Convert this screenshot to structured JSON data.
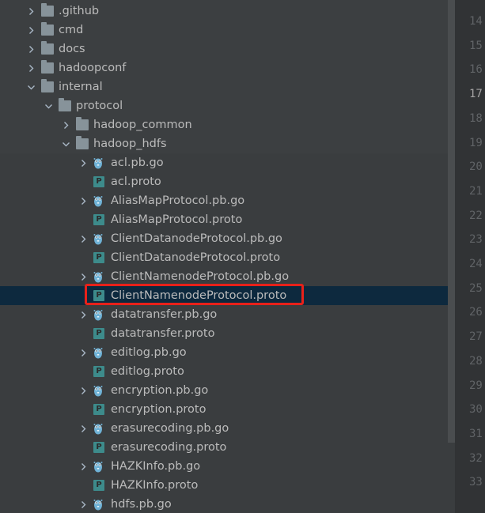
{
  "tree": {
    "rows": [
      {
        "label": ".github",
        "icon": "folder",
        "depth": 0,
        "chevron": "right"
      },
      {
        "label": "cmd",
        "icon": "folder",
        "depth": 0,
        "chevron": "right"
      },
      {
        "label": "docs",
        "icon": "folder",
        "depth": 0,
        "chevron": "right"
      },
      {
        "label": "hadoopconf",
        "icon": "folder",
        "depth": 0,
        "chevron": "right"
      },
      {
        "label": "internal",
        "icon": "folder",
        "depth": 0,
        "chevron": "down"
      },
      {
        "label": "protocol",
        "icon": "folder",
        "depth": 1,
        "chevron": "down"
      },
      {
        "label": "hadoop_common",
        "icon": "folder",
        "depth": 2,
        "chevron": "right"
      },
      {
        "label": "hadoop_hdfs",
        "icon": "folder",
        "depth": 2,
        "chevron": "down"
      },
      {
        "label": "acl.pb.go",
        "icon": "go",
        "depth": 3,
        "chevron": "right"
      },
      {
        "label": "acl.proto",
        "icon": "proto",
        "depth": 3,
        "chevron": "none"
      },
      {
        "label": "AliasMapProtocol.pb.go",
        "icon": "go",
        "depth": 3,
        "chevron": "right"
      },
      {
        "label": "AliasMapProtocol.proto",
        "icon": "proto",
        "depth": 3,
        "chevron": "none"
      },
      {
        "label": "ClientDatanodeProtocol.pb.go",
        "icon": "go",
        "depth": 3,
        "chevron": "right"
      },
      {
        "label": "ClientDatanodeProtocol.proto",
        "icon": "proto",
        "depth": 3,
        "chevron": "none"
      },
      {
        "label": "ClientNamenodeProtocol.pb.go",
        "icon": "go",
        "depth": 3,
        "chevron": "right"
      },
      {
        "label": "ClientNamenodeProtocol.proto",
        "icon": "proto",
        "depth": 3,
        "chevron": "none",
        "selected": true,
        "highlighted": true
      },
      {
        "label": "datatransfer.pb.go",
        "icon": "go",
        "depth": 3,
        "chevron": "right"
      },
      {
        "label": "datatransfer.proto",
        "icon": "proto",
        "depth": 3,
        "chevron": "none"
      },
      {
        "label": "editlog.pb.go",
        "icon": "go",
        "depth": 3,
        "chevron": "right"
      },
      {
        "label": "editlog.proto",
        "icon": "proto",
        "depth": 3,
        "chevron": "none"
      },
      {
        "label": "encryption.pb.go",
        "icon": "go",
        "depth": 3,
        "chevron": "right"
      },
      {
        "label": "encryption.proto",
        "icon": "proto",
        "depth": 3,
        "chevron": "none"
      },
      {
        "label": "erasurecoding.pb.go",
        "icon": "go",
        "depth": 3,
        "chevron": "right"
      },
      {
        "label": "erasurecoding.proto",
        "icon": "proto",
        "depth": 3,
        "chevron": "none"
      },
      {
        "label": "HAZKInfo.pb.go",
        "icon": "go",
        "depth": 3,
        "chevron": "right"
      },
      {
        "label": "HAZKInfo.proto",
        "icon": "proto",
        "depth": 3,
        "chevron": "none"
      },
      {
        "label": "hdfs.pb.go",
        "icon": "go",
        "depth": 3,
        "chevron": "right"
      }
    ]
  },
  "proto_icon_letter": "P",
  "gutter": {
    "line_numbers": [
      "14",
      "15",
      "16",
      "17",
      "18",
      "19",
      "20",
      "21",
      "22",
      "23",
      "24",
      "25",
      "26",
      "27",
      "28",
      "29",
      "30",
      "31",
      "32",
      "33"
    ],
    "current_line": "17"
  },
  "colors": {
    "tree_background": "#3c3f41",
    "selection": "#0d293e",
    "highlight_box": "#e8211a",
    "folder": "#87939a",
    "proto_icon": "#3d8b8b",
    "go_icon": "#6fb2d6"
  }
}
